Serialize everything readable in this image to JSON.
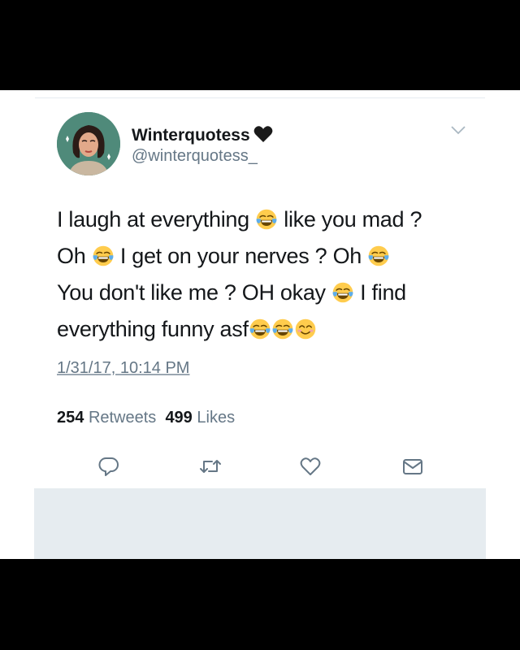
{
  "profile": {
    "display_name": "Winterquotess",
    "handle": "@winterquotess_"
  },
  "tweet": {
    "line1_a": "I laugh at everything",
    "line1_b": "like you mad ?",
    "line2_a": "Oh",
    "line2_b": "I get on your nerves ? Oh",
    "line3_a": "You don't like me ? OH okay",
    "line3_b": "I find",
    "line4_a": "everything funny asf",
    "emojis": [
      "face-with-tears-of-joy",
      "smiling-face-with-smiling-eyes"
    ]
  },
  "timestamp": "1/31/17, 10:14 PM",
  "stats": {
    "retweets_count": "254",
    "retweets_label": "Retweets",
    "likes_count": "499",
    "likes_label": "Likes"
  },
  "actions": [
    "reply-icon",
    "retweet-icon",
    "like-icon",
    "dm-icon"
  ],
  "colors": {
    "text": "#14171a",
    "secondary": "#657786",
    "divider": "#e6ecf0",
    "emoji_face": "#ffcc4d",
    "emoji_tear": "#5dadec"
  }
}
